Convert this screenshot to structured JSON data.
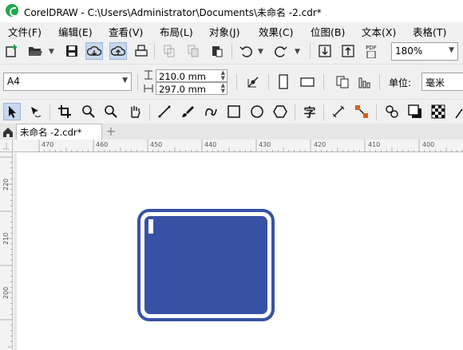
{
  "window": {
    "title": "CorelDRAW - C:\\Users\\Administrator\\Documents\\未命名 -2.cdr*"
  },
  "menu": [
    "文件(F)",
    "编辑(E)",
    "查看(V)",
    "布局(L)",
    "对象(J)",
    "效果(C)",
    "位图(B)",
    "文本(X)",
    "表格(T)"
  ],
  "toolbar": {
    "zoom_value": "180%",
    "pdf_label": "PDF"
  },
  "property_bar": {
    "page_size": "A4",
    "width": "210.0 mm",
    "height": "297.0 mm",
    "unit_label": "单位:",
    "unit_value": "毫米"
  },
  "tools": {
    "text_tool_glyph": "字"
  },
  "tabs": {
    "document": "未命名 -2.cdr*",
    "add": "+"
  },
  "ruler": {
    "horizontal": [
      "470",
      "460",
      "450",
      "440",
      "430",
      "420",
      "410",
      "400"
    ],
    "vertical": [
      "220",
      "210",
      "200"
    ]
  },
  "colors": {
    "shape_fill": "#3752a5",
    "accent_active": "#c8d8ec"
  }
}
